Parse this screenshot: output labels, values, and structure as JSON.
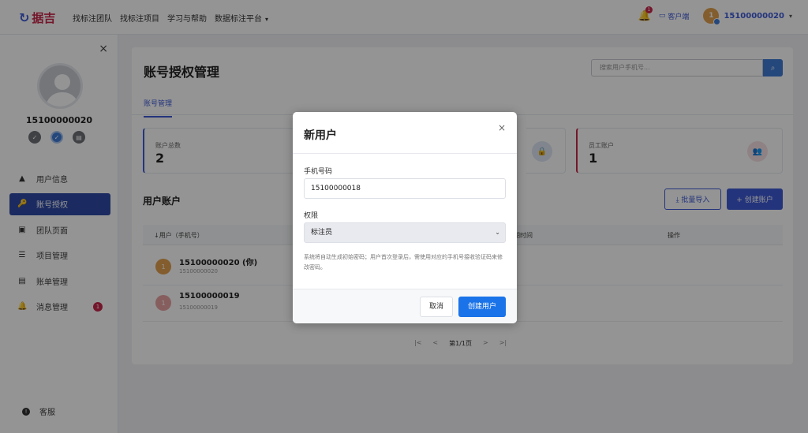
{
  "app": {
    "logo_text": "据吉",
    "logo_mark": "↻",
    "nav": [
      "找标注团队",
      "找标注项目",
      "学习与帮助",
      "数据标注平台"
    ],
    "nav_caret": "▾",
    "notification_count": "1",
    "client_label": "客户端",
    "user_avatar_text": "1",
    "user_phone": "15100000020",
    "user_caret": "▾"
  },
  "sidebar": {
    "close": "×",
    "phone": "15100000020",
    "items": [
      {
        "label": "用户信息",
        "icon": "▲"
      },
      {
        "label": "账号授权",
        "icon": "🔑"
      },
      {
        "label": "团队页面",
        "icon": "▣"
      },
      {
        "label": "项目管理",
        "icon": "☰"
      },
      {
        "label": "账单管理",
        "icon": "▤"
      },
      {
        "label": "消息管理",
        "icon": "🔔"
      }
    ],
    "message_count": "1",
    "support": "客服",
    "support_icon": "!"
  },
  "main": {
    "title": "账号授权管理",
    "search_placeholder": "搜索用户手机号...",
    "search_icon": "⌕",
    "tab": "账号管理",
    "stats": [
      {
        "label": "账户总数",
        "value": "2"
      },
      {
        "label": "员工账户",
        "value": "1"
      }
    ],
    "lock_icon": "🔒",
    "group_icon": "👥",
    "section_title": "用户账户",
    "import_button": "⤓ 批量导入",
    "create_button": "+ 创建账户",
    "columns": [
      "↓用户（手机号）",
      "期时间",
      "操作"
    ],
    "rows": [
      {
        "avatar": "1",
        "name": "15100000020 (你)",
        "sub": "15100000020",
        "color": "#e2a04e"
      },
      {
        "avatar": "1",
        "name": "15100000019",
        "sub": "15100000019",
        "color": "#e8a3a3"
      }
    ],
    "pager": [
      "|<",
      "<",
      "第1/1页",
      ">",
      ">|"
    ]
  },
  "modal": {
    "title": "新用户",
    "close": "×",
    "phone_label": "手机号码",
    "phone_value": "15100000018",
    "role_label": "权限",
    "role_value": "标注员",
    "role_arrow": "⌄",
    "hint": "系统将自动生成初始密码；用户首次登录后，需使用对应的手机号接收验证码来修改密码。",
    "cancel": "取消",
    "confirm": "创建用户"
  }
}
